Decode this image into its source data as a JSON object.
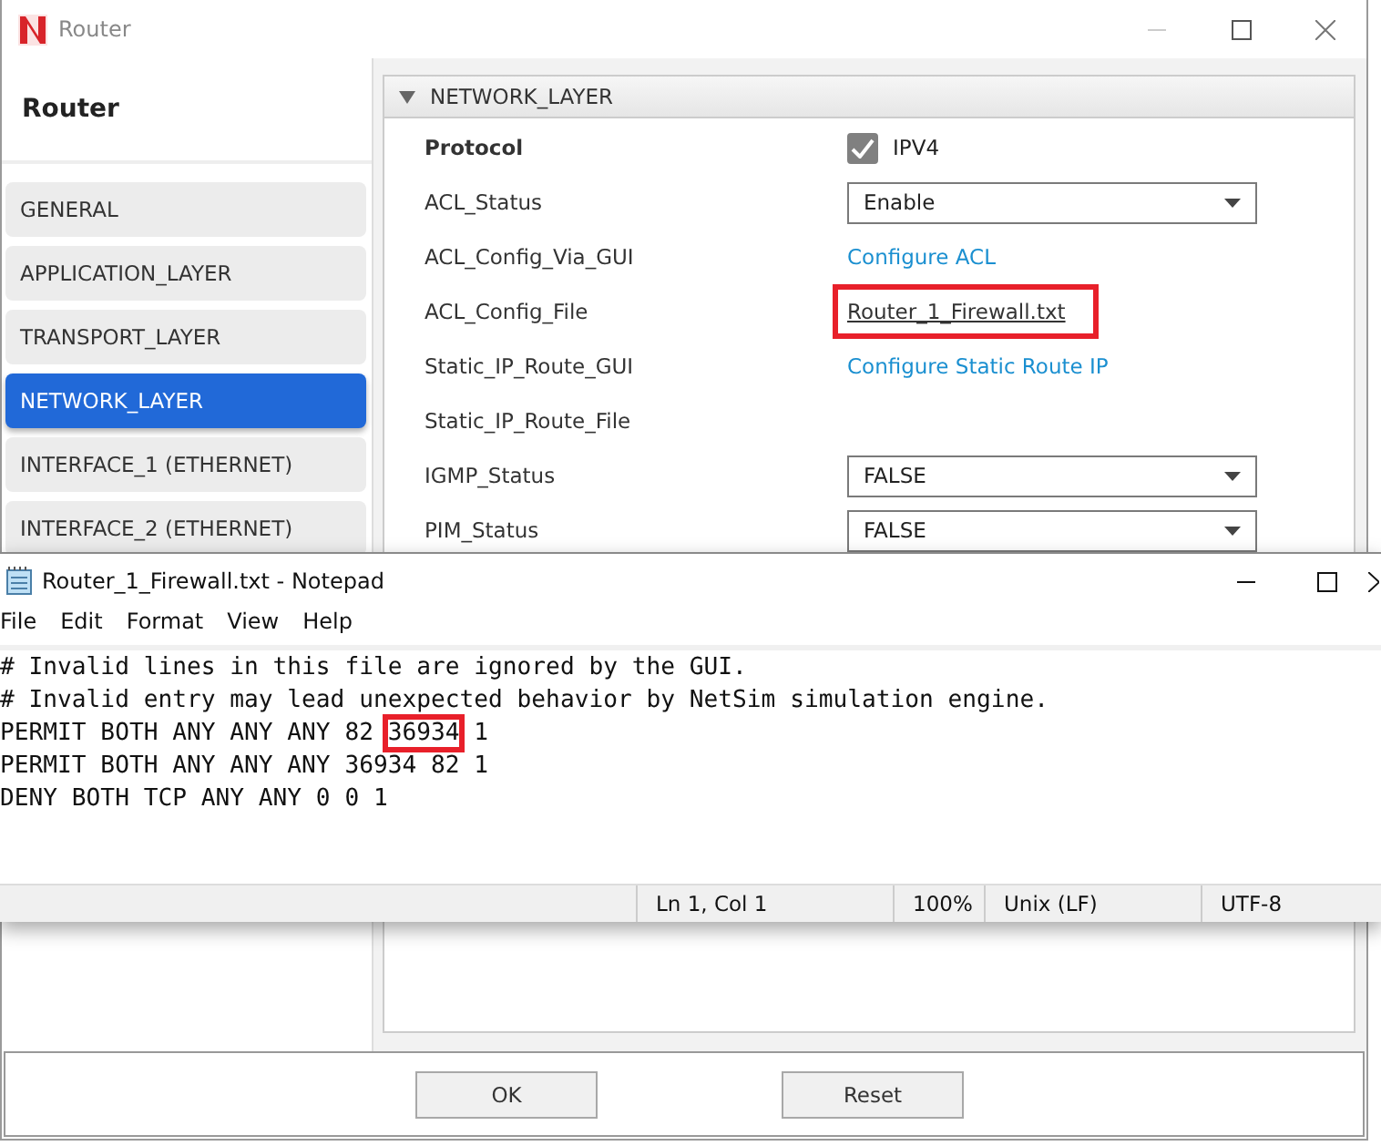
{
  "router_window": {
    "title": "Router",
    "sidebar": {
      "heading": "Router",
      "items": [
        {
          "label": "GENERAL",
          "selected": false
        },
        {
          "label": "APPLICATION_LAYER",
          "selected": false
        },
        {
          "label": "TRANSPORT_LAYER",
          "selected": false
        },
        {
          "label": "NETWORK_LAYER",
          "selected": true
        },
        {
          "label": "INTERFACE_1 (ETHERNET)",
          "selected": false
        },
        {
          "label": "INTERFACE_2 (ETHERNET)",
          "selected": false
        }
      ]
    },
    "section": {
      "title": "NETWORK_LAYER",
      "expanded": true,
      "rows": [
        {
          "label": "Protocol",
          "bold": true,
          "kind": "checkbox",
          "value": "IPV4",
          "checked": true
        },
        {
          "label": "ACL_Status",
          "bold": false,
          "kind": "dropdown",
          "value": "Enable"
        },
        {
          "label": "ACL_Config_Via_GUI",
          "bold": false,
          "kind": "link",
          "value": "Configure ACL"
        },
        {
          "label": "ACL_Config_File",
          "bold": false,
          "kind": "file",
          "value": "Router_1_Firewall.txt",
          "highlighted": true
        },
        {
          "label": "Static_IP_Route_GUI",
          "bold": false,
          "kind": "link",
          "value": "Configure Static Route IP"
        },
        {
          "label": "Static_IP_Route_File",
          "bold": false,
          "kind": "none"
        },
        {
          "label": "IGMP_Status",
          "bold": false,
          "kind": "dropdown",
          "value": "FALSE"
        },
        {
          "label": "PIM_Status",
          "bold": false,
          "kind": "dropdown",
          "value": "FALSE"
        }
      ]
    },
    "buttons": [
      "OK",
      "Reset"
    ]
  },
  "notepad": {
    "title": "Router_1_Firewall.txt - Notepad",
    "menu": [
      "File",
      "Edit",
      "Format",
      "View",
      "Help"
    ],
    "lines": [
      {
        "segments": [
          {
            "text": "# Invalid lines in this file are ignored by the GUI.",
            "highlighted": false
          }
        ]
      },
      {
        "segments": [
          {
            "text": "# Invalid entry may lead unexpected behavior by NetSim simulation engine.",
            "highlighted": false
          }
        ]
      },
      {
        "segments": [
          {
            "text": "PERMIT BOTH ANY ANY ANY 82 ",
            "highlighted": false
          },
          {
            "text": "36934",
            "highlighted": true
          },
          {
            "text": " 1",
            "highlighted": false
          }
        ]
      },
      {
        "segments": [
          {
            "text": "PERMIT BOTH ANY ANY ANY 36934 82 1",
            "highlighted": false
          }
        ]
      },
      {
        "segments": [
          {
            "text": "DENY BOTH TCP ANY ANY 0 0 1",
            "highlighted": false
          }
        ]
      }
    ],
    "status_bar": [
      "Ln 1, Col 1",
      "100%",
      "Unix (LF)",
      "UTF-8"
    ]
  }
}
